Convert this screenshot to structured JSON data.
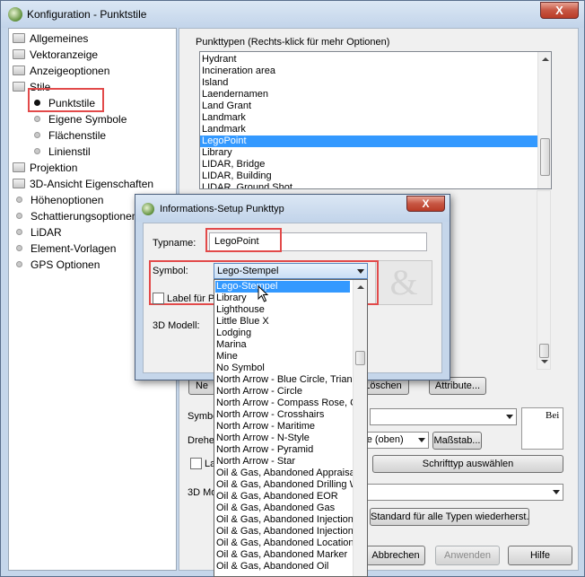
{
  "window": {
    "title": "Konfiguration - Punktstile",
    "close_glyph": "X"
  },
  "tree": [
    {
      "label": "Allgemeines",
      "kind": "folder"
    },
    {
      "label": "Vektoranzeige",
      "kind": "folder"
    },
    {
      "label": "Anzeigeoptionen",
      "kind": "folder"
    },
    {
      "label": "Stile",
      "kind": "folder"
    },
    {
      "label": "Punktstile",
      "kind": "radio",
      "selected": true
    },
    {
      "label": "Eigene Symbole",
      "kind": "radio"
    },
    {
      "label": "Flächenstile",
      "kind": "radio"
    },
    {
      "label": "Linienstil",
      "kind": "radio"
    },
    {
      "label": "Projektion",
      "kind": "folder"
    },
    {
      "label": "3D-Ansicht Eigenschaften",
      "kind": "folder"
    },
    {
      "label": "Höhenoptionen",
      "kind": "radio"
    },
    {
      "label": "Schattierungsoptionen",
      "kind": "radio"
    },
    {
      "label": "LiDAR",
      "kind": "radio"
    },
    {
      "label": "Element-Vorlagen",
      "kind": "radio"
    },
    {
      "label": "GPS Optionen",
      "kind": "radio"
    }
  ],
  "main": {
    "group_label": "Punkttypen (Rechts-klick für mehr Optionen)",
    "types": [
      "Hydrant",
      "Incineration area",
      "Island",
      "Laendernamen",
      "Land Grant",
      "Landmark",
      "Landmark",
      "LegoPoint",
      "Library",
      "LIDAR, Bridge",
      "LIDAR, Building",
      "LIDAR, Ground Shot"
    ],
    "selected_type": "LegoPoint",
    "ne_button": "Ne",
    "loeschen_button": "Löschen",
    "attribute_button": "Attribute...",
    "symbol_label": "Symbo",
    "drehe_label": "Drehe",
    "rotation_value": "rte (oben)",
    "massstab_button": "Maßstab...",
    "la_checkbox_label": "La",
    "schrifttyp_button": "Schrifttyp auswählen",
    "model3d_label": "3D Mo",
    "standard_button": "Standard für alle Typen wiederherst.",
    "preview_text": "Bei",
    "abbrechen_button": "Abbrechen",
    "anwenden_button": "Anwenden",
    "hilfe_button": "Hilfe"
  },
  "dialog": {
    "title": "Informations-Setup Punkttyp",
    "close_glyph": "X",
    "typname_label": "Typname:",
    "typname_value": "LegoPoint",
    "symbol_label": "Symbol:",
    "symbol_value": "Lego-Stempel",
    "label_checkbox": "Label für P",
    "model3d_label": "3D Modell:"
  },
  "dropdown": {
    "items": [
      "Lego-Stempel",
      "Library",
      "Lighthouse",
      "Little Blue X",
      "Lodging",
      "Marina",
      "Mine",
      "No Symbol",
      "North Arrow - Blue Circle, Triang",
      "North Arrow - Circle",
      "North Arrow - Compass Rose, Co",
      "North Arrow - Crosshairs",
      "North Arrow - Maritime",
      "North Arrow - N-Style",
      "North Arrow - Pyramid",
      "North Arrow - Star",
      "Oil & Gas, Abandoned Appraisal",
      "Oil & Gas, Abandoned Drilling W",
      "Oil & Gas, Abandoned EOR",
      "Oil & Gas, Abandoned Gas",
      "Oil & Gas, Abandoned Injection C",
      "Oil & Gas, Abandoned Injection I",
      "Oil & Gas, Abandoned Location",
      "Oil & Gas, Abandoned Marker",
      "Oil & Gas, Abandoned Oil"
    ],
    "highlighted": "Lego-Stempel"
  },
  "colors": {
    "highlight": "#3399ff",
    "annotation_red": "#e24a4a",
    "frame": "#c5d6ea"
  },
  "icons": [
    "app-icon",
    "folder-icon",
    "radio-bullet-icon",
    "chevron-down-icon",
    "mouse-cursor-icon",
    "close-icon"
  ]
}
